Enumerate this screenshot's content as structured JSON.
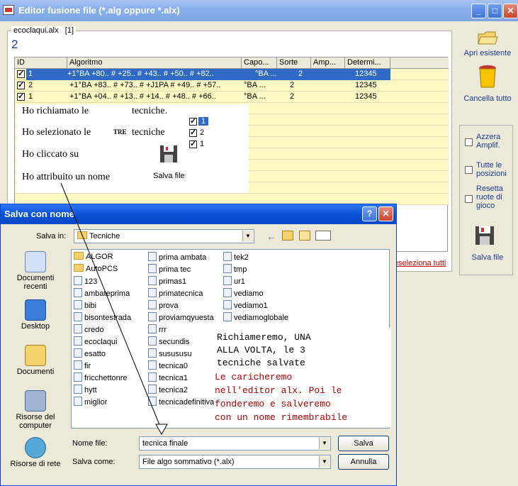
{
  "main_window": {
    "title": "Editor fusione file (*.alg oppure *.alx)",
    "minimize": "_",
    "maximize": "□",
    "close": "✕"
  },
  "group": {
    "file_label": "ecoclaqui.alx",
    "index_label": "[1]",
    "count": "2"
  },
  "grid": {
    "headers": [
      "ID",
      "Algoritmo",
      "Capo...",
      "Sorte",
      "Amp...",
      "Determi..."
    ],
    "rows": [
      {
        "id": "1",
        "algoritmo": "+1°BA +80.. # +25.. # +43.. # +50.. # +82..",
        "capo": "°BA ...",
        "sorte": "2",
        "amp": "",
        "determ": "12345"
      },
      {
        "id": "2",
        "algoritmo": "+1°BA +83.. # +73.. # +J1PA # +49.. # +57..",
        "capo": "°BA ...",
        "sorte": "2",
        "amp": "",
        "determ": "12345"
      },
      {
        "id": "1",
        "algoritmo": "+1°BA +04.. # +13.. # +14.. # +48.. # +66..",
        "capo": "°BA ...",
        "sorte": "2",
        "amp": "",
        "determ": "12345"
      }
    ]
  },
  "note": {
    "line1": "Ho richiamato le",
    "line1b": "tecniche.",
    "line2": "Ho selezionato le",
    "line2b": "TRE",
    "line2c": "tecniche",
    "line3": "Ho cliccato su",
    "line4": "Ho attribuito un nome",
    "save_label": "Salva file",
    "mini_ids": [
      "1",
      "2",
      "1"
    ]
  },
  "right_panel": {
    "open_label": "Apri esistente",
    "clear_label": "Cancella tutto",
    "cb1": "Azzera Amplif.",
    "cb2": "Tutte le posizioni",
    "cb3": "Resetta ruote di gioco",
    "save_label": "Salva file",
    "deselect_link": "eseleziona tutti"
  },
  "dialog": {
    "title": "Salva con nome",
    "help": "?",
    "close": "✕",
    "save_in_label": "Salva in:",
    "save_in_value": "Tecniche",
    "places": [
      "Documenti recenti",
      "Desktop",
      "Documenti",
      "Risorse del computer",
      "Risorse di rete"
    ],
    "col1": [
      "ALGOR",
      "AutoPCS",
      "123",
      "ambateprima",
      "bibi",
      "bisontestrada",
      "credo",
      "ecoclaqui",
      "esatto",
      "fir",
      "fricchettonre",
      "hytt",
      "miglior"
    ],
    "col2": [
      "prima ambata",
      "prima tec",
      "primas1",
      "primatecnica",
      "prova",
      "proviamqyuesta",
      "rrr",
      "secundis",
      "susususu",
      "tecnica0",
      "tecnica1",
      "tecnica2",
      "tecnicadefinitiva"
    ],
    "col3": [
      "tek2",
      "tmp",
      "ur1",
      "vediamo",
      "vediamo1",
      "vediamoglobale"
    ],
    "filename_label": "Nome file:",
    "filename_value": "tecnica finale",
    "filetype_label": "Salva come:",
    "filetype_value": "File algo sommativo (*.alx)",
    "save_button": "Salva",
    "cancel_button": "Annulla"
  },
  "annotation": {
    "black": [
      "Richiameremo, UNA",
      "ALLA VOLTA, le 3",
      "tecniche salvate"
    ],
    "red": [
      "Le caricheremo",
      "nell'editor alx. Poi le",
      "fonderemo e salveremo",
      "con un nome rimembrabile"
    ]
  }
}
